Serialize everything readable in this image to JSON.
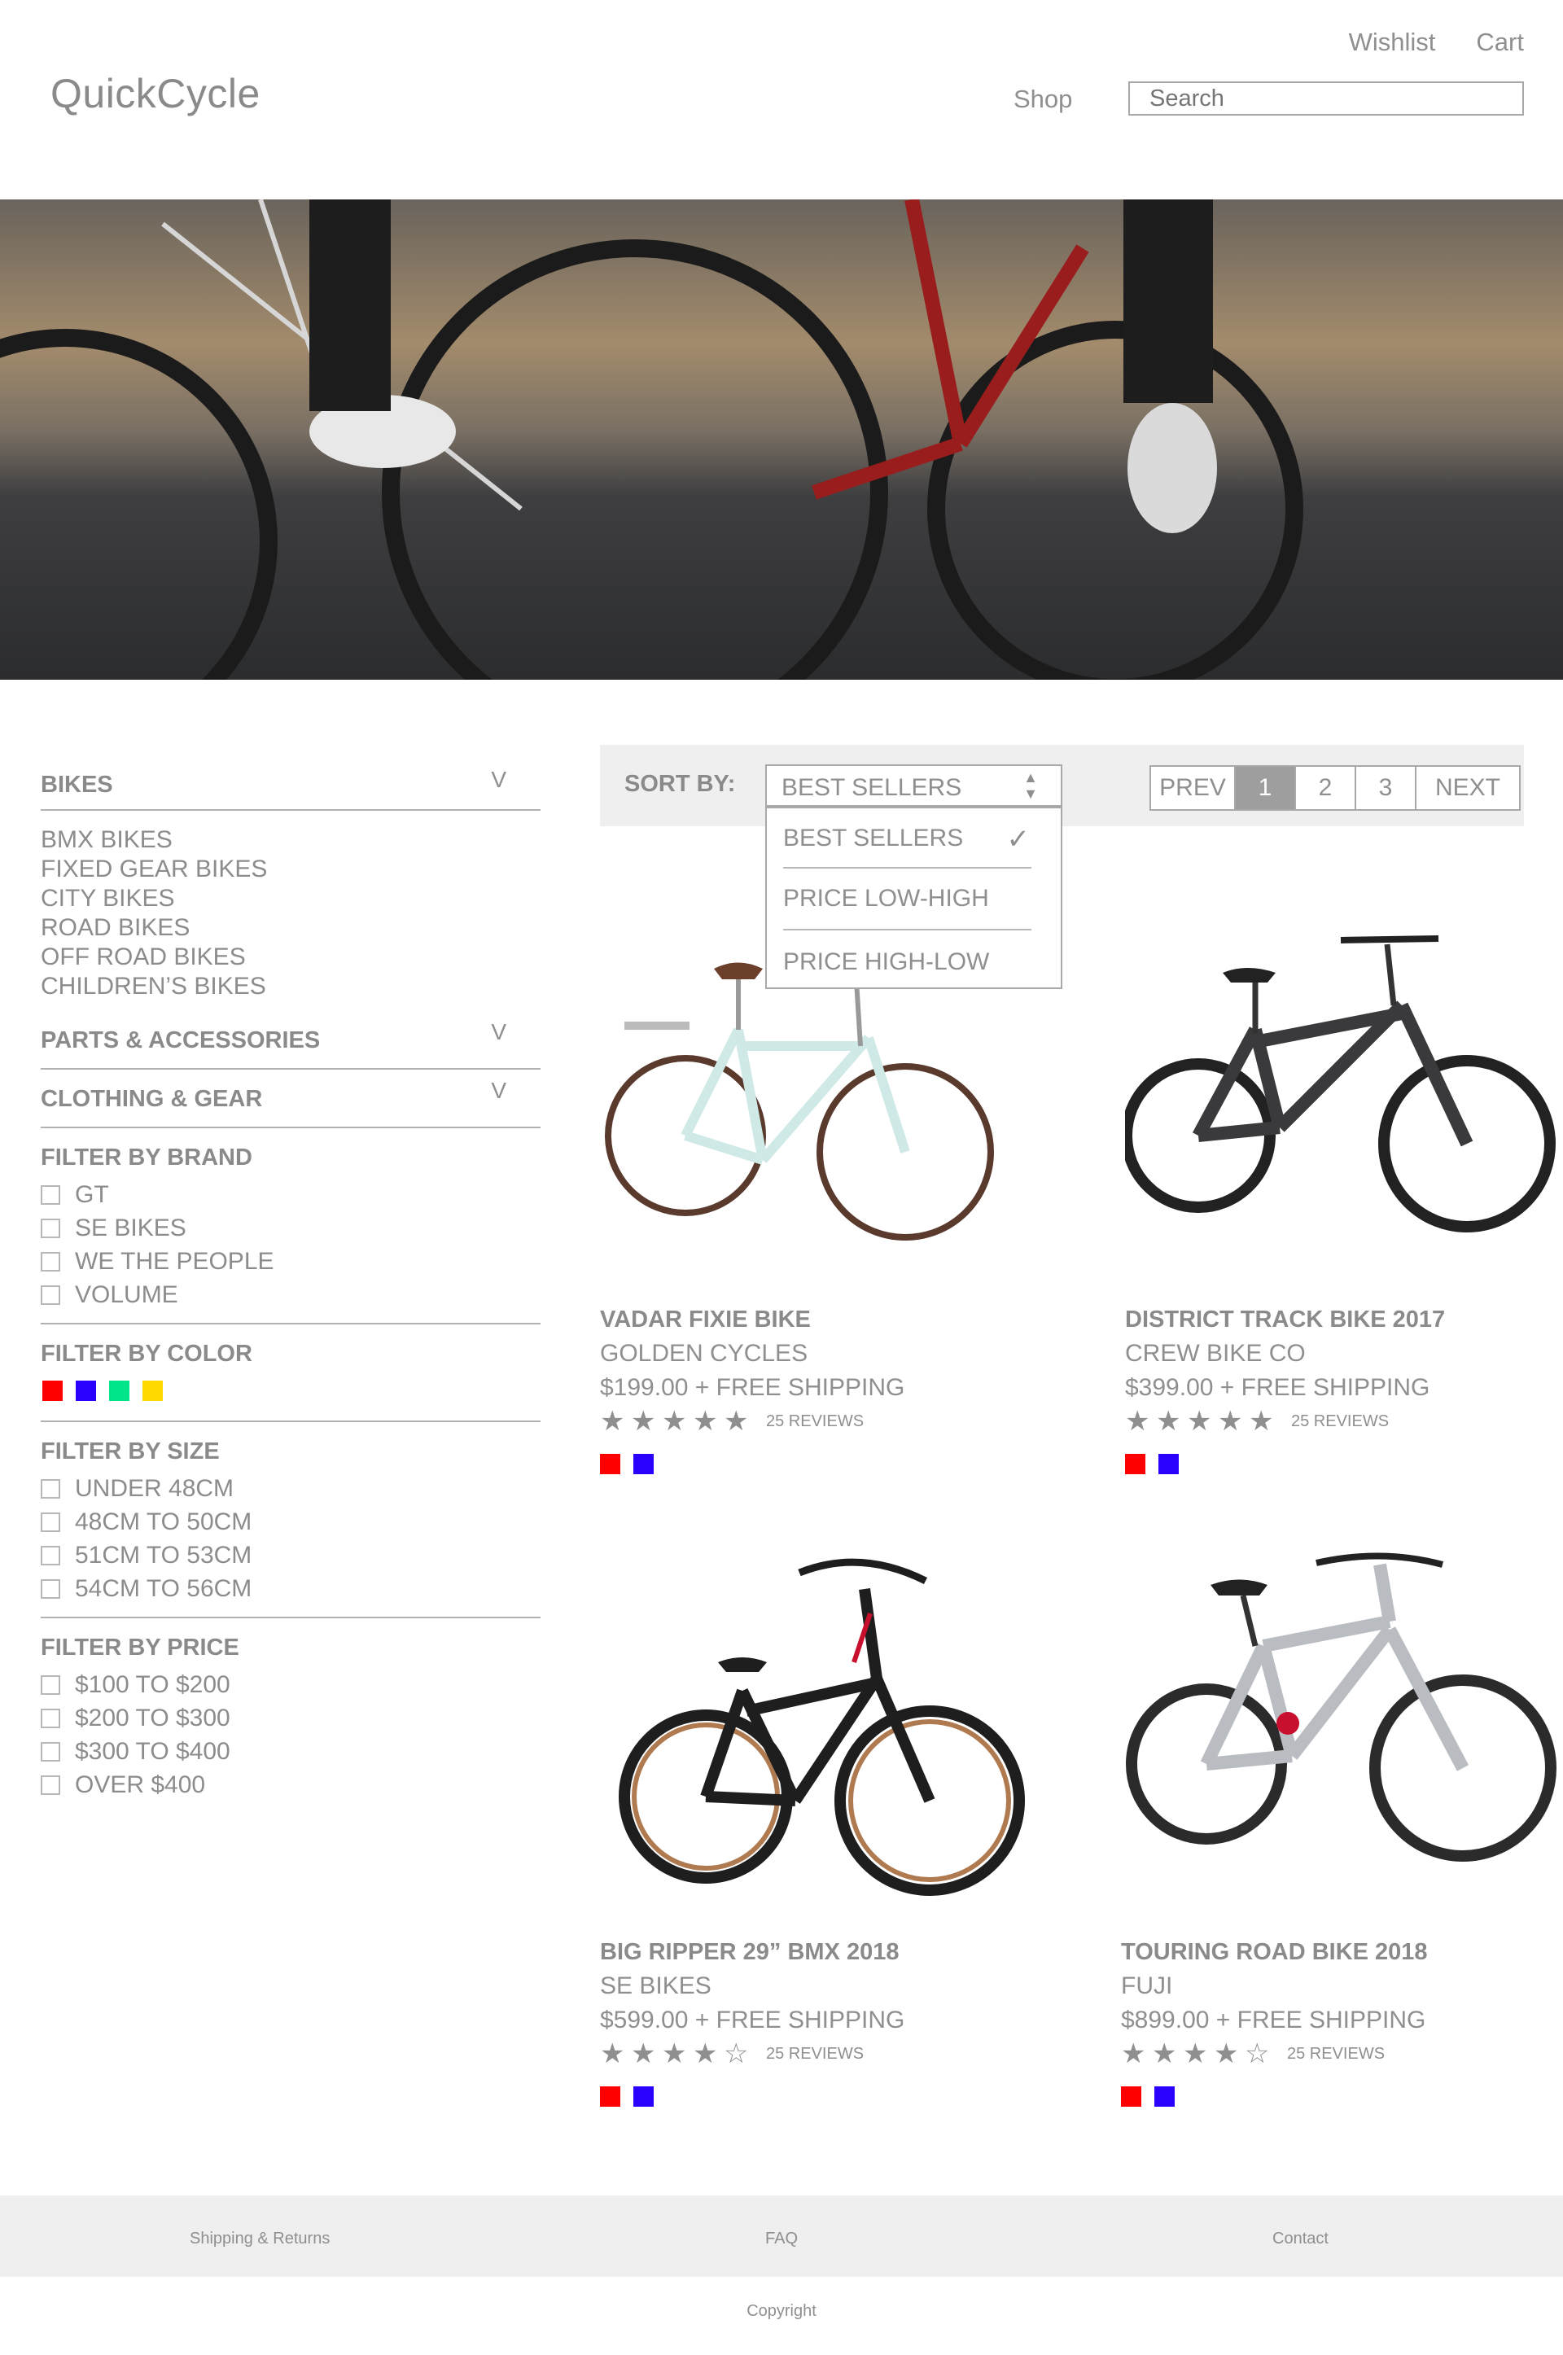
{
  "header": {
    "logo": "QuickCycle",
    "wishlist": "Wishlist",
    "cart": "Cart",
    "shop": "Shop",
    "search_placeholder": "Search"
  },
  "sidebar": {
    "bikes_title": "BIKES",
    "bikes_items": [
      "BMX BIKES",
      "FIXED GEAR BIKES",
      "CITY BIKES",
      "ROAD BIKES",
      "OFF ROAD BIKES",
      "CHILDREN’S BIKES"
    ],
    "parts_title": "PARTS & ACCESSORIES",
    "clothing_title": "CLOTHING & GEAR",
    "chevron": "V",
    "brand_title": "FILTER BY BRAND",
    "brands": [
      "GT",
      "SE BIKES",
      "WE THE PEOPLE",
      "VOLUME"
    ],
    "color_title": "FILTER BY COLOR",
    "colors": [
      "#ff0000",
      "#2a00ff",
      "#00e58a",
      "#ffd800"
    ],
    "size_title": "FILTER BY SIZE",
    "sizes": [
      "UNDER 48CM",
      "48CM TO 50CM",
      "51CM TO 53CM",
      "54CM TO 56CM"
    ],
    "price_title": "FILTER BY PRICE",
    "prices": [
      "$100 TO $200",
      "$200 TO $300",
      "$300 TO $400",
      "OVER $400"
    ]
  },
  "sort": {
    "label": "SORT BY:",
    "selected": "BEST SELLERS",
    "options": [
      "BEST SELLERS",
      "PRICE LOW-HIGH",
      "PRICE HIGH-LOW"
    ]
  },
  "pagination": {
    "prev": "PREV",
    "pages": [
      "1",
      "2",
      "3"
    ],
    "active_page": "1",
    "next": "NEXT"
  },
  "products": [
    {
      "name": "VADAR FIXIE BIKE",
      "brand": "GOLDEN CYCLES",
      "price": "$199.00 + FREE SHIPPING",
      "rating": 5,
      "reviews": "25 REVIEWS",
      "colors": [
        "#ff0000",
        "#2a00ff"
      ],
      "bike_color": "#cfe9e6",
      "icon": "city-bike-image"
    },
    {
      "name": "DISTRICT TRACK BIKE 2017",
      "brand": "CREW BIKE CO",
      "price": "$399.00 + FREE SHIPPING",
      "rating": 5,
      "reviews": "25 REVIEWS",
      "colors": [
        "#ff0000",
        "#2a00ff"
      ],
      "bike_color": "#3a3a3c",
      "icon": "mountain-bike-image"
    },
    {
      "name": "BIG RIPPER 29” BMX 2018",
      "brand": "SE BIKES",
      "price": "$599.00 + FREE SHIPPING",
      "rating": 4,
      "reviews": "25 REVIEWS",
      "colors": [
        "#ff0000",
        "#2a00ff"
      ],
      "bike_color": "#1e1e1e",
      "icon": "bmx-bike-image"
    },
    {
      "name": "TOURING ROAD BIKE 2018",
      "brand": "FUJI",
      "price": "$899.00 + FREE SHIPPING",
      "rating": 4,
      "reviews": "25 REVIEWS",
      "colors": [
        "#ff0000",
        "#2a00ff"
      ],
      "bike_color": "#b9bcc0",
      "icon": "full-suspension-bike-image"
    }
  ],
  "footer": {
    "shipping": "Shipping & Returns",
    "faq": "FAQ",
    "contact": "Contact",
    "copyright": "Copyright"
  }
}
